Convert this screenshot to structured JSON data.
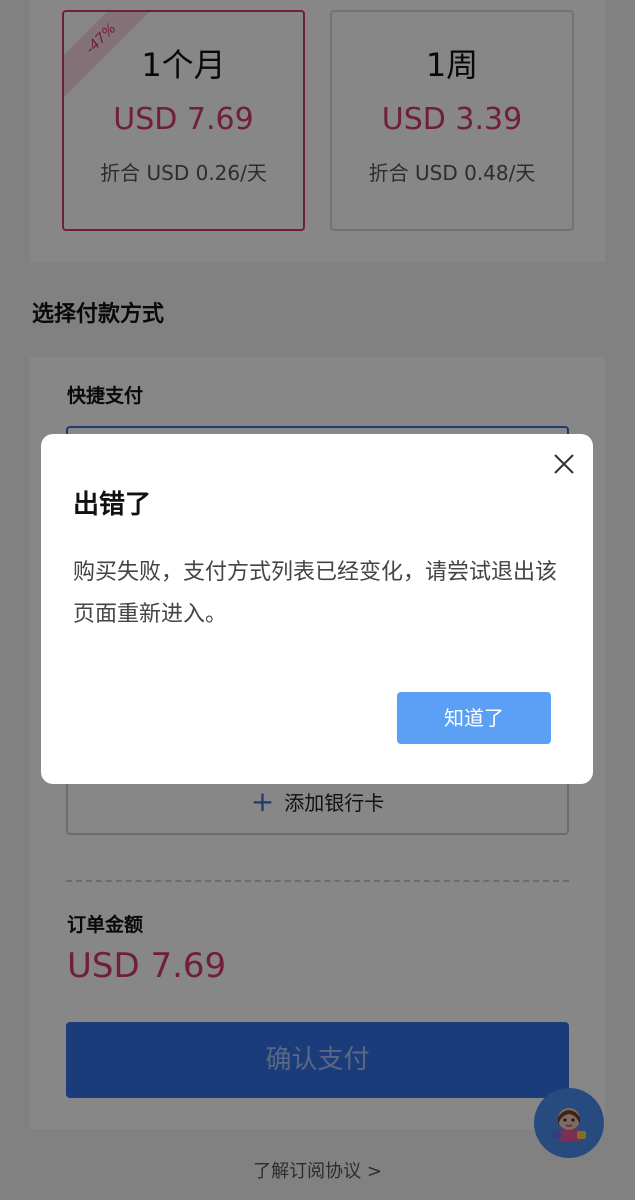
{
  "plans": [
    {
      "name": "1个月",
      "price": "USD 7.69",
      "daily": "折合 USD 0.26/天",
      "discount": "-47%",
      "selected": true
    },
    {
      "name": "1周",
      "price": "USD 3.39",
      "daily": "折合 USD 0.48/天",
      "selected": false
    }
  ],
  "payment": {
    "section_title": "选择付款方式",
    "quick_pay_label": "快捷支付",
    "add_card_label": "添加银行卡"
  },
  "order": {
    "label": "订单金额",
    "amount": "USD 7.69",
    "confirm_label": "确认支付"
  },
  "agreement_link": "了解订阅协议 >",
  "dialog": {
    "title": "出错了",
    "message": "购买失败，支付方式列表已经变化，请尝试退出该页面重新进入。",
    "button_label": "知道了"
  },
  "colors": {
    "accent": "#d63a73",
    "primary": "#3471e8",
    "dialog_button": "#5ba0f4"
  }
}
